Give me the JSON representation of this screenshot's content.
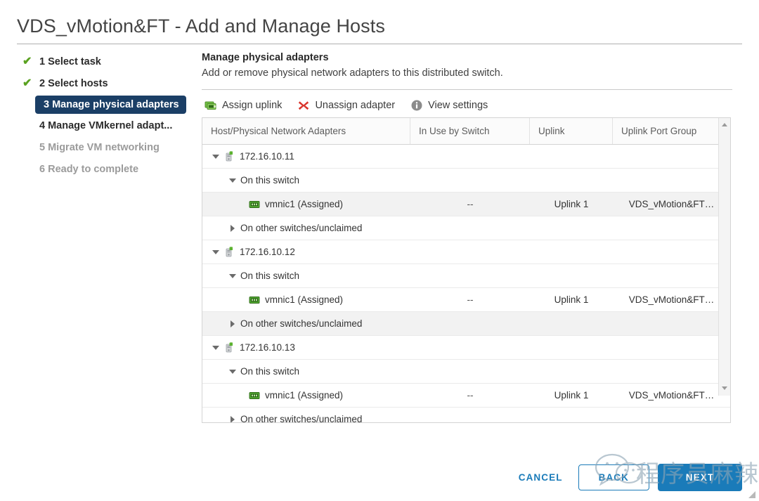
{
  "window": {
    "title": "VDS_vMotion&FT - Add and Manage Hosts"
  },
  "steps": [
    {
      "label": "1 Select task",
      "state": "done",
      "check": "✔"
    },
    {
      "label": "2 Select hosts",
      "state": "done",
      "check": "✔"
    },
    {
      "label": "3 Manage physical adapters",
      "state": "active"
    },
    {
      "label": "4 Manage VMkernel adapt...",
      "state": "next"
    },
    {
      "label": "5 Migrate VM networking",
      "state": "pending"
    },
    {
      "label": "6 Ready to complete",
      "state": "pending"
    }
  ],
  "pane": {
    "title": "Manage physical adapters",
    "subtitle": "Add or remove physical network adapters to this distributed switch."
  },
  "toolbar": {
    "assign_uplink": "Assign uplink",
    "unassign_adapter": "Unassign adapter",
    "view_settings": "View settings",
    "assign_icon": "assign-uplink-icon",
    "unassign_icon": "red-x-icon",
    "settings_icon": "info-circle-icon"
  },
  "table": {
    "columns": [
      "Host/Physical Network Adapters",
      "In Use by Switch",
      "Uplink",
      "Uplink Port Group"
    ],
    "rows": [
      {
        "level": 0,
        "twisty": "open",
        "icon": "host-icon",
        "label": "172.16.10.11",
        "in_use": "",
        "uplink": "",
        "port_group": "",
        "shaded": false
      },
      {
        "level": 1,
        "twisty": "open",
        "icon": "none",
        "label": "On this switch",
        "in_use": "",
        "uplink": "",
        "port_group": "",
        "shaded": false
      },
      {
        "level": 2,
        "twisty": "none",
        "icon": "adapter-icon",
        "label": "vmnic1 (Assigned)",
        "in_use": "--",
        "uplink": "Uplink 1",
        "port_group": "VDS_vMotion&FT…",
        "shaded": true
      },
      {
        "level": 1,
        "twisty": "closed",
        "icon": "none",
        "label": "On other switches/unclaimed",
        "in_use": "",
        "uplink": "",
        "port_group": "",
        "shaded": false
      },
      {
        "level": 0,
        "twisty": "open",
        "icon": "host-icon",
        "label": "172.16.10.12",
        "in_use": "",
        "uplink": "",
        "port_group": "",
        "shaded": false
      },
      {
        "level": 1,
        "twisty": "open",
        "icon": "none",
        "label": "On this switch",
        "in_use": "",
        "uplink": "",
        "port_group": "",
        "shaded": false
      },
      {
        "level": 2,
        "twisty": "none",
        "icon": "adapter-icon",
        "label": "vmnic1 (Assigned)",
        "in_use": "--",
        "uplink": "Uplink 1",
        "port_group": "VDS_vMotion&FT…",
        "shaded": false
      },
      {
        "level": 1,
        "twisty": "closed",
        "icon": "none",
        "label": "On other switches/unclaimed",
        "in_use": "",
        "uplink": "",
        "port_group": "",
        "shaded": true
      },
      {
        "level": 0,
        "twisty": "open",
        "icon": "host-icon",
        "label": "172.16.10.13",
        "in_use": "",
        "uplink": "",
        "port_group": "",
        "shaded": false
      },
      {
        "level": 1,
        "twisty": "open",
        "icon": "none",
        "label": "On this switch",
        "in_use": "",
        "uplink": "",
        "port_group": "",
        "shaded": false
      },
      {
        "level": 2,
        "twisty": "none",
        "icon": "adapter-icon",
        "label": "vmnic1 (Assigned)",
        "in_use": "--",
        "uplink": "Uplink 1",
        "port_group": "VDS_vMotion&FT…",
        "shaded": false
      },
      {
        "level": 1,
        "twisty": "closed",
        "icon": "none",
        "label": "On other switches/unclaimed",
        "in_use": "",
        "uplink": "",
        "port_group": "",
        "shaded": false
      }
    ]
  },
  "footer": {
    "cancel": "CANCEL",
    "back": "BACK",
    "next": "NEXT"
  },
  "watermark": {
    "text": "程序员麻辣烫",
    "logo": "wechat-logo"
  },
  "colors": {
    "accent_blue": "#1a7bb9",
    "active_step": "#1b3f66",
    "check_green": "#5aa220",
    "unassign_red": "#d9342b"
  }
}
